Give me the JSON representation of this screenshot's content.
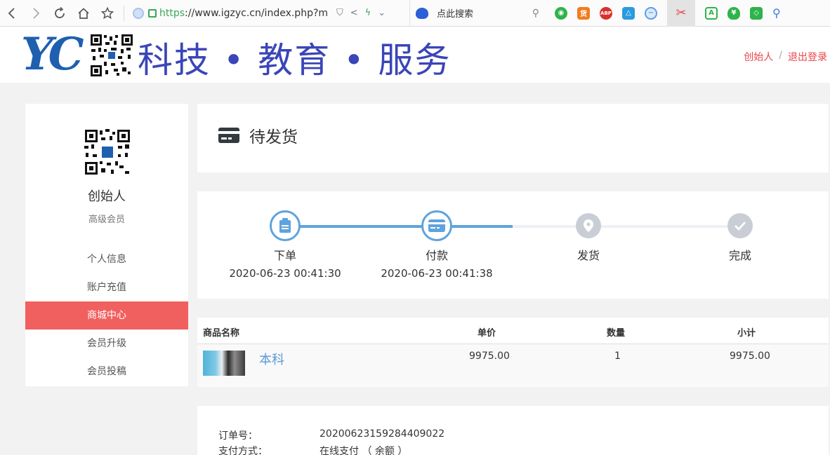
{
  "browser": {
    "url_scheme": "https",
    "url_rest": "://www.igzyc.cn/index.php?m=",
    "search_placeholder": "点此搜索",
    "ext_huo": "货",
    "ext_abp": "ABP"
  },
  "header": {
    "logo_text": "YC",
    "slogan": "科技 • 教育 • 服务",
    "user_link": "创始人",
    "separator": "/",
    "logout_link": "退出登录"
  },
  "sidebar": {
    "name": "创始人",
    "level": "高级会员",
    "items": [
      {
        "label": "个人信息"
      },
      {
        "label": "账户充值"
      },
      {
        "label": "商城中心"
      },
      {
        "label": "会员升级"
      },
      {
        "label": "会员投稿"
      }
    ],
    "active_index": 2
  },
  "order": {
    "status_title": "待发货",
    "steps": [
      {
        "label": "下单",
        "time": "2020-06-23 00:41:30",
        "done": true,
        "icon": "clipboard-icon"
      },
      {
        "label": "付款",
        "time": "2020-06-23 00:41:38",
        "done": true,
        "icon": "card-icon"
      },
      {
        "label": "发货",
        "time": "",
        "done": false,
        "icon": "location-pin-icon"
      },
      {
        "label": "完成",
        "time": "",
        "done": false,
        "icon": "check-icon"
      }
    ],
    "table": {
      "headers": [
        "商品名称",
        "单价",
        "数量",
        "小计"
      ],
      "rows": [
        {
          "name": "本科",
          "price": "9975.00",
          "qty": "1",
          "subtotal": "9975.00"
        }
      ]
    },
    "info": [
      {
        "key": "订单号：",
        "value": "20200623159284409022"
      },
      {
        "key": "支付方式：",
        "value": "在线支付 （ 余额 ）"
      }
    ]
  },
  "colors": {
    "accent_red": "#f0605f",
    "step_blue": "#5ea3dd",
    "step_gray": "#c9ced6",
    "link_red": "#e8454b",
    "slogan_blue": "#3a45b8"
  }
}
